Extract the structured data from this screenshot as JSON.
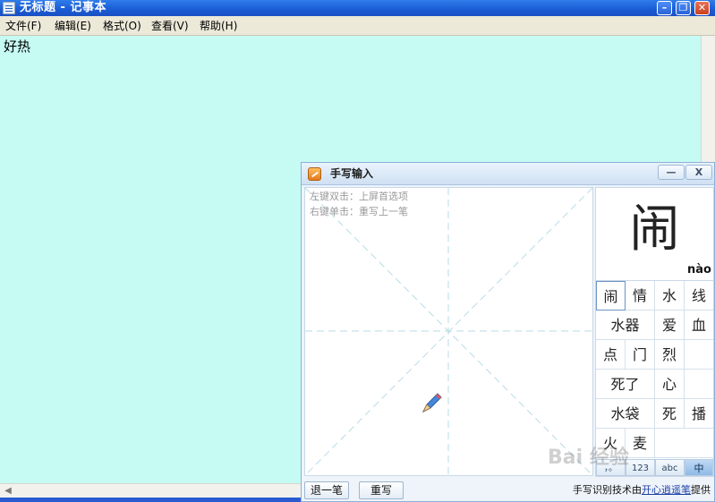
{
  "notepad": {
    "title": "无标题 - 记事本",
    "menu": [
      "文件(F)",
      "编辑(E)",
      "格式(O)",
      "查看(V)",
      "帮助(H)"
    ],
    "text": "好热",
    "window_buttons": {
      "minimize": "–",
      "maximize": "❐",
      "close": "✕"
    },
    "scroll_left_arrow": "◀"
  },
  "handwriting": {
    "title": "手写输入",
    "window_buttons": {
      "minimize": "—",
      "close": "X"
    },
    "hints": [
      "左键双击：上屏首选项",
      "右键单击：重写上一笔"
    ],
    "preview_char": "闹",
    "preview_pinyin": "nào",
    "candidates": [
      [
        "闹",
        "情",
        "水",
        "线"
      ],
      [
        "水器",
        "爱",
        "血"
      ],
      [
        "点",
        "门",
        "烈",
        ""
      ],
      [
        "死了",
        "心",
        ""
      ],
      [
        "水袋",
        "死",
        "播"
      ],
      [
        "火",
        "麦",
        ""
      ]
    ],
    "modes": [
      "，。",
      "123",
      "abc",
      "中"
    ],
    "buttons": {
      "undo": "退一笔",
      "rewrite": "重写"
    },
    "credit_prefix": "手写识别技术由",
    "credit_link": "开心逍遥笔",
    "credit_suffix": "提供"
  },
  "watermark": "Bai 经验",
  "colors": {
    "editor_bg": "#c6fbf4",
    "titlebar": "#1a5bd4",
    "panel_bg": "#eef4fa"
  },
  "icons": [
    "notepad-icon",
    "handwriting-app-icon",
    "pen-icon"
  ]
}
